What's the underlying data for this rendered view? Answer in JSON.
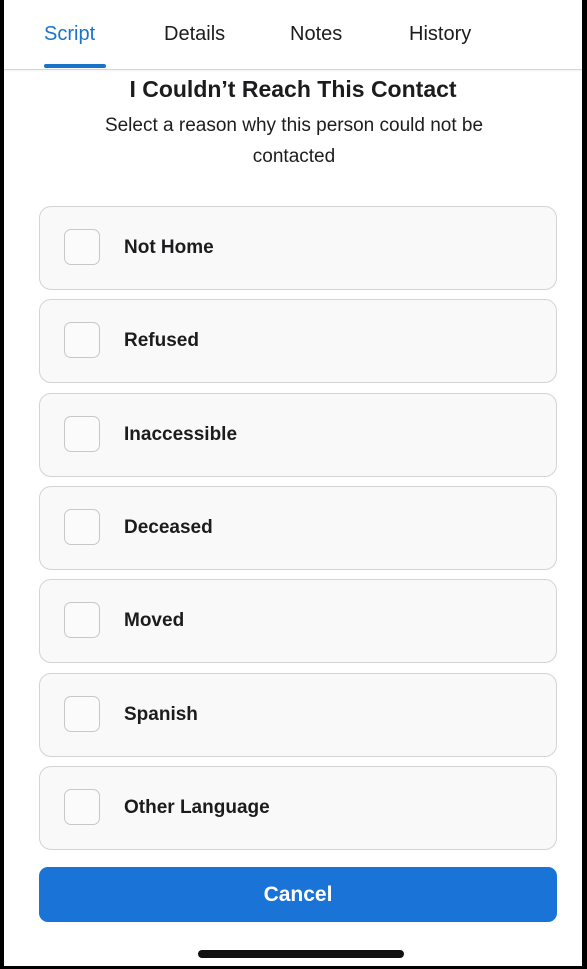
{
  "tabs": [
    {
      "label": "Script",
      "active": true
    },
    {
      "label": "Details",
      "active": false
    },
    {
      "label": "Notes",
      "active": false
    },
    {
      "label": "History",
      "active": false
    }
  ],
  "header": {
    "title": "I Couldn’t Reach This Contact",
    "subtitle": "Select a reason why this person could not be contacted"
  },
  "reasons": [
    {
      "label": "Not Home",
      "checked": false
    },
    {
      "label": "Refused",
      "checked": false
    },
    {
      "label": "Inaccessible",
      "checked": false
    },
    {
      "label": "Deceased",
      "checked": false
    },
    {
      "label": "Moved",
      "checked": false
    },
    {
      "label": "Spanish",
      "checked": false
    },
    {
      "label": "Other Language",
      "checked": false
    }
  ],
  "actions": {
    "cancel_label": "Cancel"
  },
  "colors": {
    "accent": "#1a73c9",
    "button": "#1a73d6"
  }
}
